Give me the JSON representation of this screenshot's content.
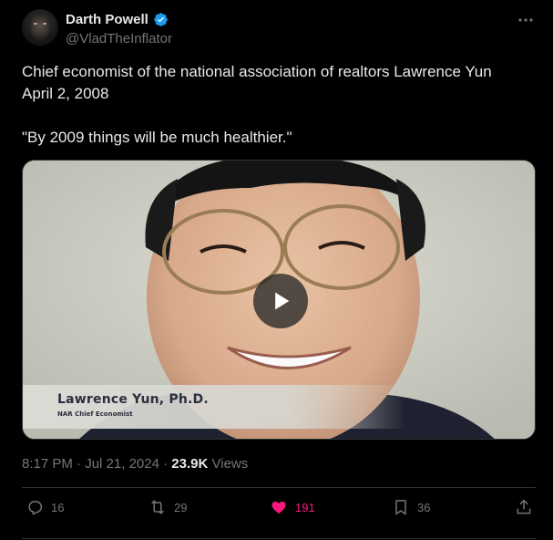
{
  "author": {
    "display_name": "Darth Powell",
    "handle": "@VladTheInflator",
    "verified": true
  },
  "post": {
    "lines": [
      "Chief economist of the national association of realtors Lawrence Yun",
      "April 2, 2008",
      "\"By 2009 things will be much healthier.\""
    ],
    "video": {
      "caption_name": "Lawrence Yun, Ph.D.",
      "caption_title": "NAR Chief Economist"
    },
    "time": "8:17 PM",
    "date": "Jul 21, 2024",
    "separator": "·",
    "views_count": "23.9K",
    "views_label": "Views"
  },
  "actions": {
    "replies": "16",
    "reposts": "29",
    "likes": "191",
    "bookmarks": "36"
  },
  "colors": {
    "background": "#000000",
    "text": "#e7e9ea",
    "muted": "#71767b",
    "verified_blue": "#1d9bf0",
    "like_pink": "#f91880"
  }
}
